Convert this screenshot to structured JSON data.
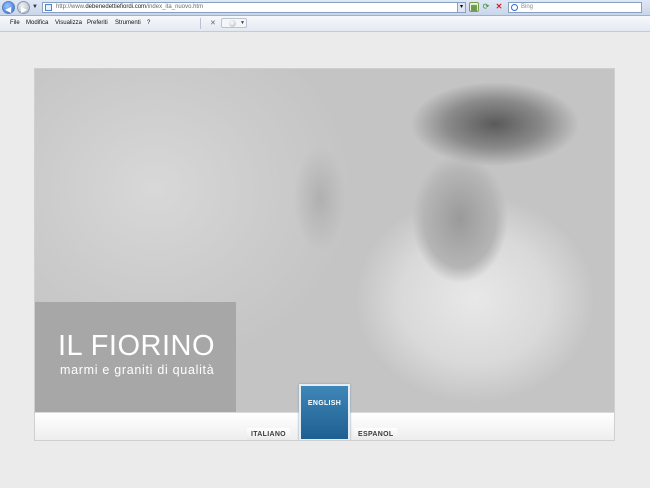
{
  "browser": {
    "url_prefix": "http://www.",
    "url_domain": "debenedettiefiordi.com",
    "url_path": "/index_ita_nuovo.htm",
    "search_placeholder": "Bing"
  },
  "menubar": {
    "items": [
      "File",
      "Modifica",
      "Visualizza",
      "Preferiti",
      "Strumenti",
      "?"
    ]
  },
  "site": {
    "title": "IL FIORINO",
    "subtitle": "marmi e graniti di qualità",
    "languages": {
      "italiano": "ITALIANO",
      "english": "ENGLISH",
      "espanol": "ESPANOL"
    },
    "accent_color": "#2b6f9f",
    "panel_color": "#a7a7a7"
  }
}
